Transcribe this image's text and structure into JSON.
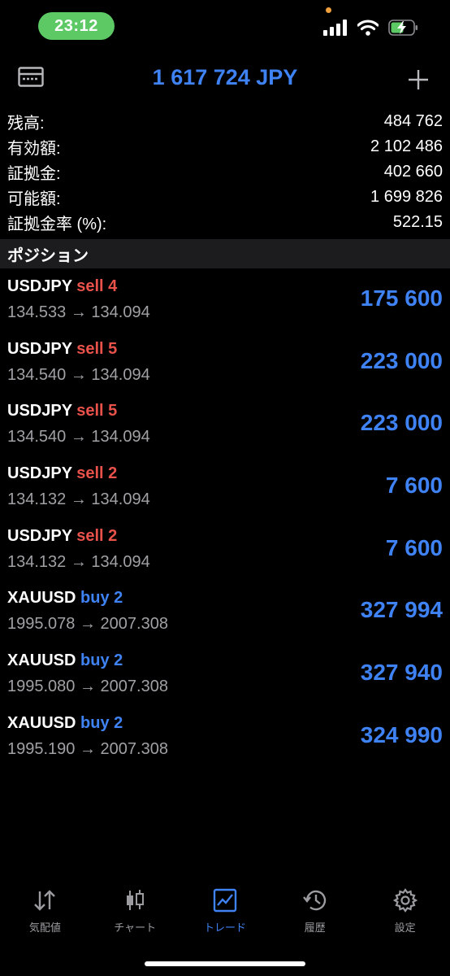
{
  "status_bar": {
    "time": "23:12",
    "colors": {
      "pill": "#5cc965",
      "battery": "#5cc965"
    }
  },
  "header": {
    "title": "1 617 724 JPY"
  },
  "summary": [
    {
      "label": "残高:",
      "value": "484 762"
    },
    {
      "label": "有効額:",
      "value": "2 102 486"
    },
    {
      "label": "証拠金:",
      "value": "402 660"
    },
    {
      "label": "可能額:",
      "value": "1 699 826"
    },
    {
      "label": "証拠金率 (%):",
      "value": "522.15"
    }
  ],
  "section": {
    "title": "ポジション"
  },
  "positions": [
    {
      "symbol": "USDJPY",
      "side": "sell 4",
      "type": "sell",
      "prices": "134.533 → 134.094",
      "profit": "175 600"
    },
    {
      "symbol": "USDJPY",
      "side": "sell 5",
      "type": "sell",
      "prices": "134.540 → 134.094",
      "profit": "223 000"
    },
    {
      "symbol": "USDJPY",
      "side": "sell 5",
      "type": "sell",
      "prices": "134.540 → 134.094",
      "profit": "223 000"
    },
    {
      "symbol": "USDJPY",
      "side": "sell 2",
      "type": "sell",
      "prices": "134.132 → 134.094",
      "profit": "7 600"
    },
    {
      "symbol": "USDJPY",
      "side": "sell 2",
      "type": "sell",
      "prices": "134.132 → 134.094",
      "profit": "7 600"
    },
    {
      "symbol": "XAUUSD",
      "side": "buy 2",
      "type": "buy",
      "prices": "1995.078 → 2007.308",
      "profit": "327 994"
    },
    {
      "symbol": "XAUUSD",
      "side": "buy 2",
      "type": "buy",
      "prices": "1995.080 → 2007.308",
      "profit": "327 940"
    },
    {
      "symbol": "XAUUSD",
      "side": "buy 2",
      "type": "buy",
      "prices": "1995.190 → 2007.308",
      "profit": "324 990"
    }
  ],
  "tabs": [
    {
      "label": "気配値",
      "icon": "arrows-up-down-icon",
      "active": false
    },
    {
      "label": "チャート",
      "icon": "candlestick-icon",
      "active": false
    },
    {
      "label": "トレード",
      "icon": "trade-chart-icon",
      "active": true
    },
    {
      "label": "履歴",
      "icon": "history-icon",
      "active": false
    },
    {
      "label": "設定",
      "icon": "gear-icon",
      "active": false
    }
  ],
  "colors": {
    "accent": "#3f82f3",
    "sell": "#e9524a",
    "secondary_text": "#a0a0a5",
    "section_bg": "#1c1c1e"
  }
}
